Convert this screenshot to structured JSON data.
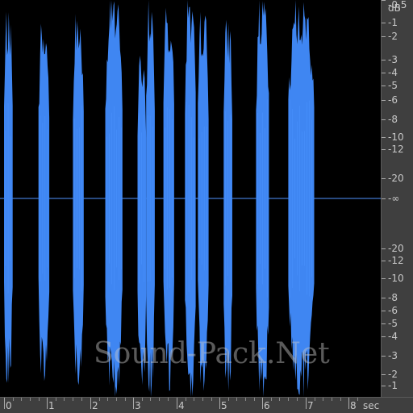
{
  "colors": {
    "background": "#000000",
    "waveform": "#3f86f2",
    "waveform_dark": "#2a6fd6",
    "centerline": "#4f95ff",
    "ruler_bg": "#3f3f3f",
    "ruler_text": "#c8c8c8"
  },
  "db_scale": {
    "unit_label": "dB",
    "labels": [
      "-1",
      "-2",
      "-3",
      "-4",
      "-5",
      "-6",
      "-8",
      "-10",
      "-12",
      "-20",
      "-∞",
      "-20",
      "-12",
      "-10",
      "-8",
      "-6",
      "-5",
      "-4",
      "-3",
      "-2",
      "-1",
      "-0,5"
    ]
  },
  "time_ruler": {
    "unit_label": "sec",
    "labels": [
      "0",
      "1",
      "2",
      "3",
      "4",
      "5",
      "6",
      "7",
      "8"
    ]
  },
  "watermark": {
    "text": "Sound-Pack.Net"
  },
  "chart_data": {
    "type": "area",
    "title": "",
    "xlabel": "sec",
    "ylabel": "dB",
    "xlim": [
      0,
      8.5
    ],
    "segments": [
      {
        "start": 0.0,
        "end": 0.2,
        "peak_top": 0.94,
        "peak_bottom": 0.93
      },
      {
        "start": 0.8,
        "end": 1.05,
        "peak_top": 0.88,
        "peak_bottom": 0.92
      },
      {
        "start": 1.6,
        "end": 1.85,
        "peak_top": 0.93,
        "peak_bottom": 0.94
      },
      {
        "start": 2.35,
        "end": 2.75,
        "peak_top": 1.0,
        "peak_bottom": 1.0
      },
      {
        "start": 3.1,
        "end": 3.3,
        "peak_top": 0.72,
        "peak_bottom": 0.94
      },
      {
        "start": 3.3,
        "end": 3.5,
        "peak_top": 1.0,
        "peak_bottom": 1.0
      },
      {
        "start": 3.7,
        "end": 3.95,
        "peak_top": 0.96,
        "peak_bottom": 0.97
      },
      {
        "start": 4.2,
        "end": 4.45,
        "peak_top": 1.0,
        "peak_bottom": 1.0
      },
      {
        "start": 4.5,
        "end": 4.75,
        "peak_top": 0.94,
        "peak_bottom": 0.97
      },
      {
        "start": 5.1,
        "end": 5.3,
        "peak_top": 0.9,
        "peak_bottom": 0.97
      },
      {
        "start": 5.85,
        "end": 6.15,
        "peak_top": 1.0,
        "peak_bottom": 1.0
      },
      {
        "start": 6.6,
        "end": 7.2,
        "peak_top": 1.0,
        "peak_bottom": 1.0
      }
    ]
  }
}
